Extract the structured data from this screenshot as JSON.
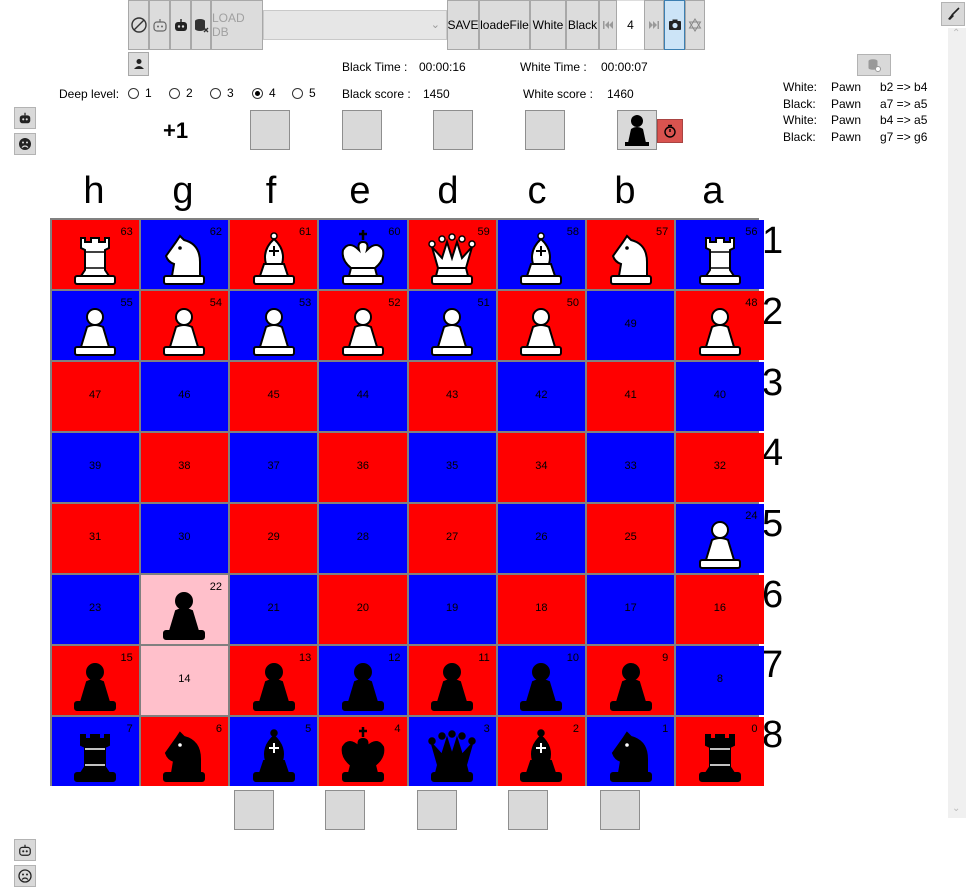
{
  "toolbar": {
    "load_db": "LOAD DB",
    "save": "SAVE",
    "load_file": "loadeFile",
    "white": "White",
    "black": "Black",
    "move_index": "4",
    "db_selected": ""
  },
  "info": {
    "black_time_label": "Black Time :",
    "black_time": "00:00:16",
    "white_time_label": "White Time :",
    "white_time": "00:00:07",
    "black_score_label": "Black score :",
    "black_score": "1450",
    "white_score_label": "White score :",
    "white_score": "1460",
    "advantage": "+1"
  },
  "deep_level": {
    "label": "Deep level:",
    "options": [
      "1",
      "2",
      "3",
      "4",
      "5"
    ],
    "selected": "4"
  },
  "move_log": [
    {
      "side": "White:",
      "piece": "Pawn",
      "move": "b2 => b4"
    },
    {
      "side": "Black:",
      "piece": "Pawn",
      "move": "a7 => a5"
    },
    {
      "side": "White:",
      "piece": "Pawn",
      "move": "b4 => a5"
    },
    {
      "side": "Black:",
      "piece": "Pawn",
      "move": "g7 => g6"
    }
  ],
  "board": {
    "columns": [
      "h",
      "g",
      "f",
      "e",
      "d",
      "c",
      "b",
      "a"
    ],
    "rows": [
      "1",
      "2",
      "3",
      "4",
      "5",
      "6",
      "7",
      "8"
    ],
    "colors": {
      "red": "#ff0000",
      "blue": "#0000ff",
      "highlight": "#ffc0cb",
      "grid": "#808080"
    },
    "squares": [
      [
        {
          "n": "63",
          "c": "red",
          "p": "wR"
        },
        {
          "n": "62",
          "c": "blue",
          "p": "wN"
        },
        {
          "n": "61",
          "c": "red",
          "p": "wB"
        },
        {
          "n": "60",
          "c": "blue",
          "p": "wK"
        },
        {
          "n": "59",
          "c": "red",
          "p": "wQ"
        },
        {
          "n": "58",
          "c": "blue",
          "p": "wB"
        },
        {
          "n": "57",
          "c": "red",
          "p": "wN"
        },
        {
          "n": "56",
          "c": "blue",
          "p": "wR"
        }
      ],
      [
        {
          "n": "55",
          "c": "blue",
          "p": "wP"
        },
        {
          "n": "54",
          "c": "red",
          "p": "wP"
        },
        {
          "n": "53",
          "c": "blue",
          "p": "wP"
        },
        {
          "n": "52",
          "c": "red",
          "p": "wP"
        },
        {
          "n": "51",
          "c": "blue",
          "p": "wP"
        },
        {
          "n": "50",
          "c": "red",
          "p": "wP"
        },
        {
          "n": "49",
          "c": "blue",
          "p": ""
        },
        {
          "n": "48",
          "c": "red",
          "p": "wP"
        }
      ],
      [
        {
          "n": "47",
          "c": "red",
          "p": ""
        },
        {
          "n": "46",
          "c": "blue",
          "p": ""
        },
        {
          "n": "45",
          "c": "red",
          "p": ""
        },
        {
          "n": "44",
          "c": "blue",
          "p": ""
        },
        {
          "n": "43",
          "c": "red",
          "p": ""
        },
        {
          "n": "42",
          "c": "blue",
          "p": ""
        },
        {
          "n": "41",
          "c": "red",
          "p": ""
        },
        {
          "n": "40",
          "c": "blue",
          "p": ""
        }
      ],
      [
        {
          "n": "39",
          "c": "blue",
          "p": ""
        },
        {
          "n": "38",
          "c": "red",
          "p": ""
        },
        {
          "n": "37",
          "c": "blue",
          "p": ""
        },
        {
          "n": "36",
          "c": "red",
          "p": ""
        },
        {
          "n": "35",
          "c": "blue",
          "p": ""
        },
        {
          "n": "34",
          "c": "red",
          "p": ""
        },
        {
          "n": "33",
          "c": "blue",
          "p": ""
        },
        {
          "n": "32",
          "c": "red",
          "p": ""
        }
      ],
      [
        {
          "n": "31",
          "c": "red",
          "p": ""
        },
        {
          "n": "30",
          "c": "blue",
          "p": ""
        },
        {
          "n": "29",
          "c": "red",
          "p": ""
        },
        {
          "n": "28",
          "c": "blue",
          "p": ""
        },
        {
          "n": "27",
          "c": "red",
          "p": ""
        },
        {
          "n": "26",
          "c": "blue",
          "p": ""
        },
        {
          "n": "25",
          "c": "red",
          "p": ""
        },
        {
          "n": "24",
          "c": "blue",
          "p": "wP"
        }
      ],
      [
        {
          "n": "23",
          "c": "blue",
          "p": ""
        },
        {
          "n": "22",
          "c": "pink",
          "p": "bP"
        },
        {
          "n": "21",
          "c": "blue",
          "p": ""
        },
        {
          "n": "20",
          "c": "red",
          "p": ""
        },
        {
          "n": "19",
          "c": "blue",
          "p": ""
        },
        {
          "n": "18",
          "c": "red",
          "p": ""
        },
        {
          "n": "17",
          "c": "blue",
          "p": ""
        },
        {
          "n": "16",
          "c": "red",
          "p": ""
        }
      ],
      [
        {
          "n": "15",
          "c": "red",
          "p": "bP"
        },
        {
          "n": "14",
          "c": "pink",
          "p": ""
        },
        {
          "n": "13",
          "c": "red",
          "p": "bP"
        },
        {
          "n": "12",
          "c": "blue",
          "p": "bP"
        },
        {
          "n": "11",
          "c": "red",
          "p": "bP"
        },
        {
          "n": "10",
          "c": "blue",
          "p": "bP"
        },
        {
          "n": "9",
          "c": "red",
          "p": "bP"
        },
        {
          "n": "8",
          "c": "blue",
          "p": ""
        }
      ],
      [
        {
          "n": "7",
          "c": "blue",
          "p": "bR"
        },
        {
          "n": "6",
          "c": "red",
          "p": "bN"
        },
        {
          "n": "5",
          "c": "blue",
          "p": "bB"
        },
        {
          "n": "4",
          "c": "red",
          "p": "bK"
        },
        {
          "n": "3",
          "c": "blue",
          "p": "bQ"
        },
        {
          "n": "2",
          "c": "red",
          "p": "bB"
        },
        {
          "n": "1",
          "c": "blue",
          "p": "bN"
        },
        {
          "n": "0",
          "c": "red",
          "p": "bR"
        }
      ]
    ]
  },
  "icons": {
    "rotate": "rotate-board-icon",
    "robot_outline": "robot-outline-icon",
    "robot": "robot-icon",
    "db_delete": "database-delete-icon",
    "first": "first-move-icon",
    "last": "last-move-icon",
    "camera": "camera-icon",
    "star": "star-of-david-icon",
    "broom": "broom-icon",
    "person": "person-icon",
    "db": "database-icon",
    "sad": "sad-face-icon",
    "timer": "stopwatch-icon"
  }
}
